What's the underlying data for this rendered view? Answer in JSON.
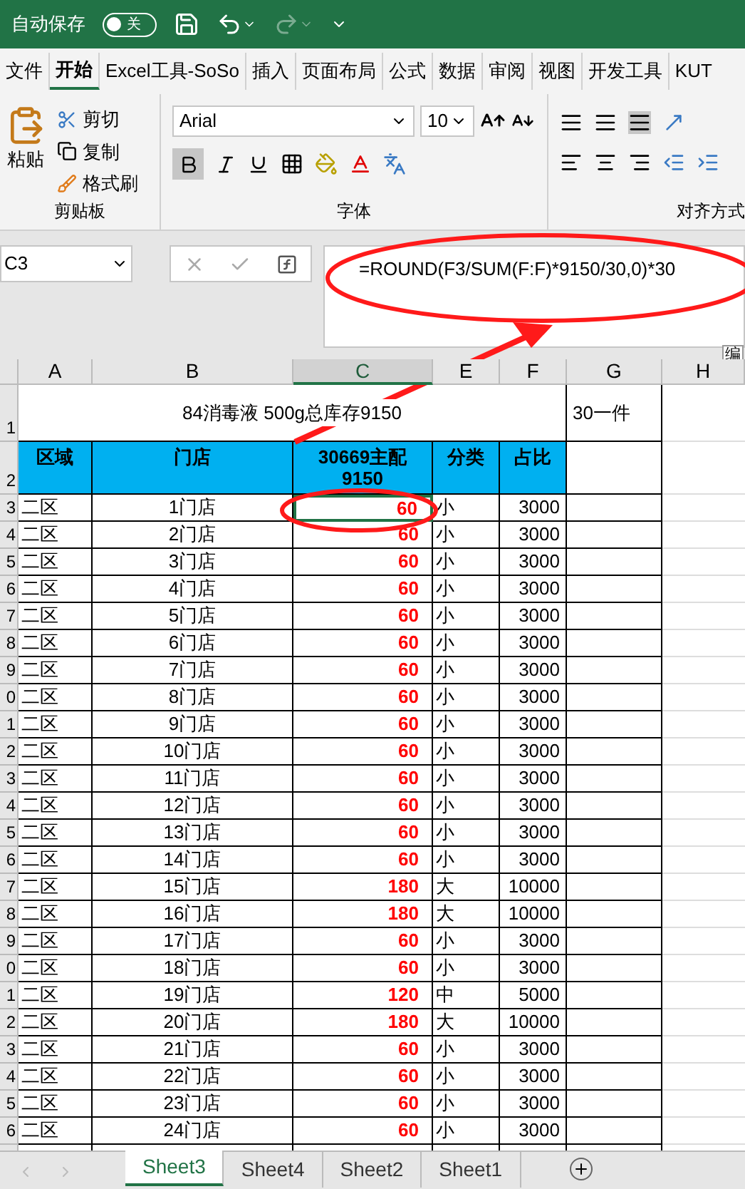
{
  "title_bar": {
    "autosave_label": "自动保存",
    "autosave_toggle": {
      "label": "关",
      "on": false
    }
  },
  "ribbon_tabs": [
    {
      "label": "文件",
      "selected": false
    },
    {
      "label": "开始",
      "selected": true
    },
    {
      "label": "Excel工具-SoSo",
      "selected": false
    },
    {
      "label": "插入",
      "selected": false
    },
    {
      "label": "页面布局",
      "selected": false
    },
    {
      "label": "公式",
      "selected": false
    },
    {
      "label": "数据",
      "selected": false
    },
    {
      "label": "审阅",
      "selected": false
    },
    {
      "label": "视图",
      "selected": false
    },
    {
      "label": "开发工具",
      "selected": false
    },
    {
      "label": "KUT",
      "selected": false
    }
  ],
  "clipboard": {
    "paste": "粘贴",
    "cut": "剪切",
    "copy": "复制",
    "format_painter": "格式刷",
    "group_label": "剪贴板"
  },
  "font": {
    "name": "Arial",
    "size": "10",
    "bold": true,
    "group_label": "字体"
  },
  "alignment": {
    "group_label": "对齐方式"
  },
  "formula_bar": {
    "name_box": "C3",
    "formula": "=ROUND(F3/SUM(F:F)*9150/30,0)*30",
    "tooltip": "编"
  },
  "columns": [
    {
      "label": "A",
      "selected": false
    },
    {
      "label": "B",
      "selected": false
    },
    {
      "label": "C",
      "selected": true
    },
    {
      "label": "E",
      "selected": false
    },
    {
      "label": "F",
      "selected": false
    },
    {
      "label": "G",
      "selected": false
    },
    {
      "label": "H",
      "selected": false
    }
  ],
  "title_row": {
    "row_label": "1",
    "title": "84消毒液 500g总库存9150",
    "note": "30一件"
  },
  "header_row": {
    "row_label": "2",
    "headers": [
      "区域",
      "门店",
      "30669主配9150",
      "分类",
      "占比"
    ]
  },
  "rows": [
    {
      "row_label": "3",
      "area": "二区",
      "store": "1门店",
      "alloc": "60",
      "category": "小",
      "ratio": "3000",
      "selected": true
    },
    {
      "row_label": "4",
      "area": "二区",
      "store": "2门店",
      "alloc": "60",
      "category": "小",
      "ratio": "3000",
      "selected": false
    },
    {
      "row_label": "5",
      "area": "二区",
      "store": "3门店",
      "alloc": "60",
      "category": "小",
      "ratio": "3000",
      "selected": false
    },
    {
      "row_label": "6",
      "area": "二区",
      "store": "4门店",
      "alloc": "60",
      "category": "小",
      "ratio": "3000",
      "selected": false
    },
    {
      "row_label": "7",
      "area": "二区",
      "store": "5门店",
      "alloc": "60",
      "category": "小",
      "ratio": "3000",
      "selected": false
    },
    {
      "row_label": "8",
      "area": "二区",
      "store": "6门店",
      "alloc": "60",
      "category": "小",
      "ratio": "3000",
      "selected": false
    },
    {
      "row_label": "9",
      "area": "二区",
      "store": "7门店",
      "alloc": "60",
      "category": "小",
      "ratio": "3000",
      "selected": false
    },
    {
      "row_label": "0",
      "area": "二区",
      "store": "8门店",
      "alloc": "60",
      "category": "小",
      "ratio": "3000",
      "selected": false
    },
    {
      "row_label": "1",
      "area": "二区",
      "store": "9门店",
      "alloc": "60",
      "category": "小",
      "ratio": "3000",
      "selected": false
    },
    {
      "row_label": "2",
      "area": "二区",
      "store": "10门店",
      "alloc": "60",
      "category": "小",
      "ratio": "3000",
      "selected": false
    },
    {
      "row_label": "3",
      "area": "二区",
      "store": "11门店",
      "alloc": "60",
      "category": "小",
      "ratio": "3000",
      "selected": false
    },
    {
      "row_label": "4",
      "area": "二区",
      "store": "12门店",
      "alloc": "60",
      "category": "小",
      "ratio": "3000",
      "selected": false
    },
    {
      "row_label": "5",
      "area": "二区",
      "store": "13门店",
      "alloc": "60",
      "category": "小",
      "ratio": "3000",
      "selected": false
    },
    {
      "row_label": "6",
      "area": "二区",
      "store": "14门店",
      "alloc": "60",
      "category": "小",
      "ratio": "3000",
      "selected": false
    },
    {
      "row_label": "7",
      "area": "二区",
      "store": "15门店",
      "alloc": "180",
      "category": "大",
      "ratio": "10000",
      "selected": false
    },
    {
      "row_label": "8",
      "area": "二区",
      "store": "16门店",
      "alloc": "180",
      "category": "大",
      "ratio": "10000",
      "selected": false
    },
    {
      "row_label": "9",
      "area": "二区",
      "store": "17门店",
      "alloc": "60",
      "category": "小",
      "ratio": "3000",
      "selected": false
    },
    {
      "row_label": "0",
      "area": "二区",
      "store": "18门店",
      "alloc": "60",
      "category": "小",
      "ratio": "3000",
      "selected": false
    },
    {
      "row_label": "1",
      "area": "二区",
      "store": "19门店",
      "alloc": "120",
      "category": "中",
      "ratio": "5000",
      "selected": false
    },
    {
      "row_label": "2",
      "area": "二区",
      "store": "20门店",
      "alloc": "180",
      "category": "大",
      "ratio": "10000",
      "selected": false
    },
    {
      "row_label": "3",
      "area": "二区",
      "store": "21门店",
      "alloc": "60",
      "category": "小",
      "ratio": "3000",
      "selected": false
    },
    {
      "row_label": "4",
      "area": "二区",
      "store": "22门店",
      "alloc": "60",
      "category": "小",
      "ratio": "3000",
      "selected": false
    },
    {
      "row_label": "5",
      "area": "二区",
      "store": "23门店",
      "alloc": "60",
      "category": "小",
      "ratio": "3000",
      "selected": false
    },
    {
      "row_label": "6",
      "area": "二区",
      "store": "24门店",
      "alloc": "60",
      "category": "小",
      "ratio": "3000",
      "selected": false
    }
  ],
  "sheet_tabs": [
    {
      "label": "Sheet3",
      "selected": true
    },
    {
      "label": "Sheet4",
      "selected": false
    },
    {
      "label": "Sheet2",
      "selected": false
    },
    {
      "label": "Sheet1",
      "selected": false
    }
  ]
}
